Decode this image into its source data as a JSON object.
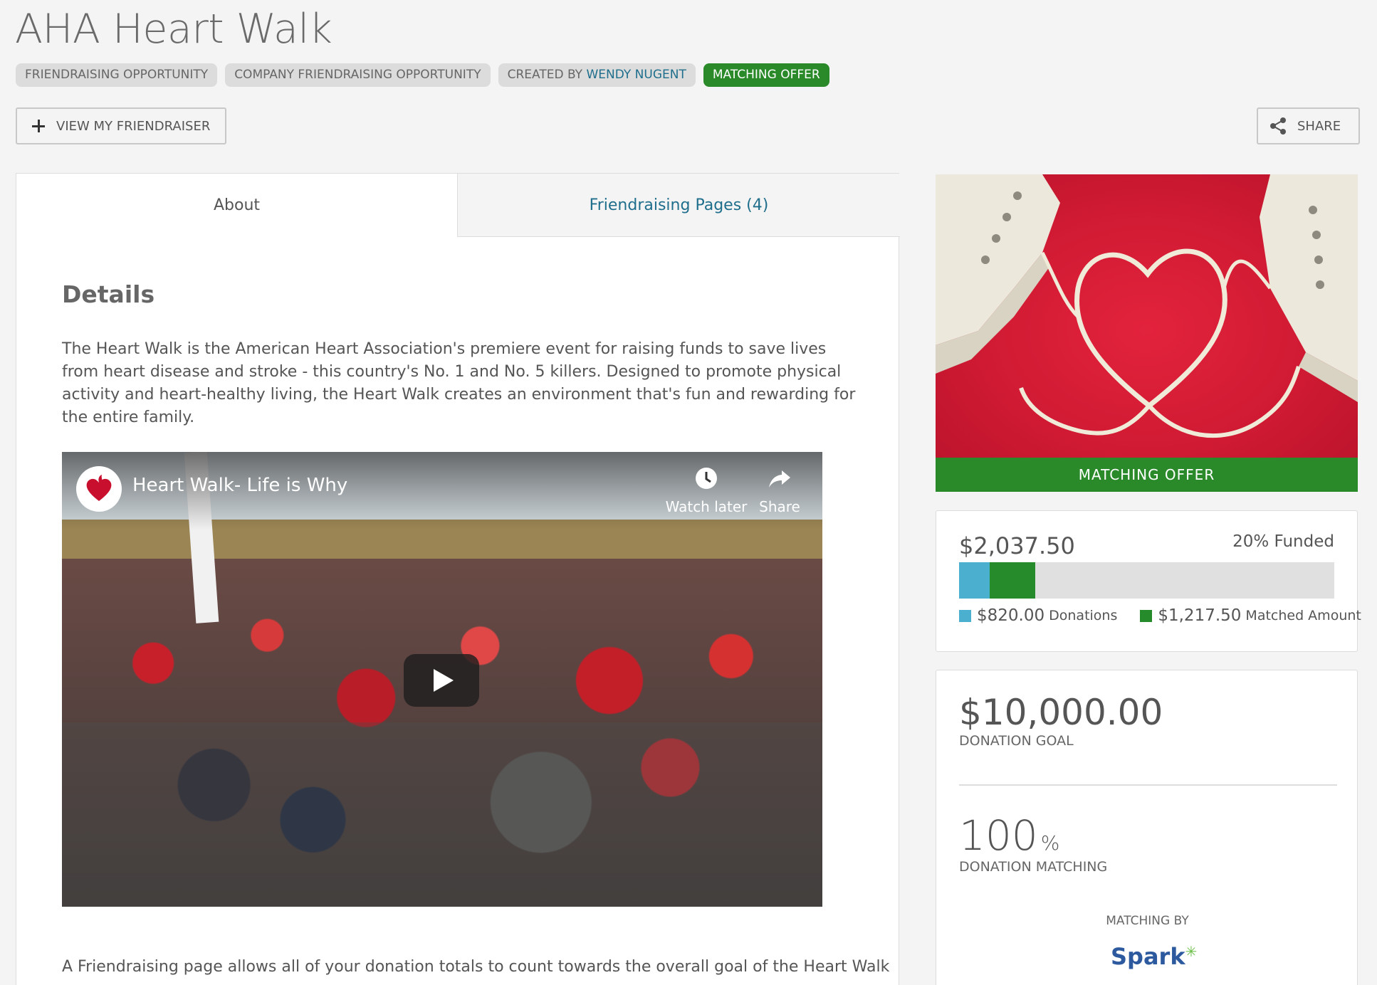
{
  "page": {
    "title": "AHA Heart Walk"
  },
  "tags": {
    "friendraising": "FRIENDRAISING OPPORTUNITY",
    "company": "COMPANY FRIENDRAISING OPPORTUNITY",
    "created_prefix": "CREATED BY ",
    "created_name": "WENDY NUGENT",
    "matching": "MATCHING OFFER"
  },
  "actions": {
    "view_friendraiser": "VIEW MY FRIENDRAISER",
    "share": "SHARE"
  },
  "tabs": [
    {
      "label": "About",
      "active": true
    },
    {
      "label": "Friendraising Pages (4)",
      "active": false
    }
  ],
  "about": {
    "details_title": "Details",
    "details_text": "The Heart Walk is the American Heart Association's premiere event for raising funds to save lives from heart disease and stroke - this country's No. 1 and No. 5 killers. Designed to promote physical activity and heart-healthy living, the Heart Walk creates an environment that's fun and rewarding for the entire family.",
    "bottom_text": "A Friendraising page allows all of your donation totals to count towards the overall goal of the Heart Walk"
  },
  "video": {
    "title": "Heart Walk- Life is Why",
    "watch_later": "Watch later",
    "share": "Share"
  },
  "sidebar": {
    "badge": "MATCHING OFFER",
    "raised": "$2,037.50",
    "funded": "20% Funded",
    "donations_fraction": 0.082,
    "matched_fraction": 0.122,
    "donations_amount": "$820.00",
    "donations_label": "Donations",
    "matched_amount": "$1,217.50",
    "matched_label": "Matched Amount",
    "goal_amount": "$10,000.00",
    "goal_label": "DONATION GOAL",
    "matching_value": "100",
    "matching_unit": "%",
    "matching_label": "DONATION MATCHING",
    "matching_by": "MATCHING BY",
    "sponsor": "Spark"
  },
  "colors": {
    "accent_green": "#2a8a2a",
    "link_blue": "#1f6e8c",
    "donations_blue": "#4bb0d0",
    "matched_green": "#268c2b"
  },
  "icons": [
    "plus-icon",
    "share-icon",
    "clock-icon",
    "share-arrow-icon",
    "play-icon",
    "aha-logo-icon"
  ]
}
